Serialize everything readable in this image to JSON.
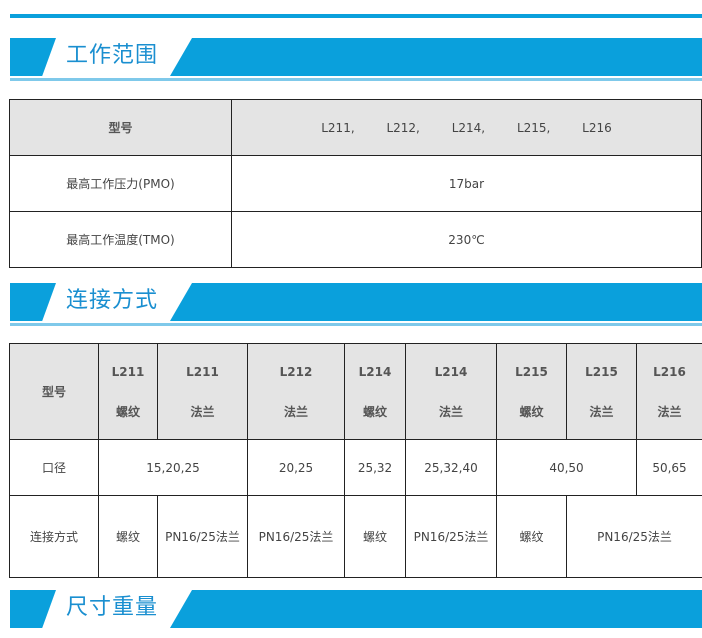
{
  "sections": {
    "working_range": {
      "title": "工作范围"
    },
    "connection": {
      "title": "连接方式"
    },
    "dimensions": {
      "title": "尺寸重量"
    }
  },
  "table1": {
    "header": {
      "label": "型号",
      "models": [
        "L211,",
        "L212,",
        "L214,",
        "L215,",
        "L216"
      ]
    },
    "rows": [
      {
        "label": "最高工作压力(PMO)",
        "value": "17bar"
      },
      {
        "label": "最高工作温度(TMO)",
        "value": "230℃"
      }
    ]
  },
  "table2": {
    "header_label": "型号",
    "columns": [
      {
        "model": "L211",
        "type": "螺纹"
      },
      {
        "model": "L211",
        "type": "法兰"
      },
      {
        "model": "L212",
        "type": "法兰"
      },
      {
        "model": "L214",
        "type": "螺纹"
      },
      {
        "model": "L214",
        "type": "法兰"
      },
      {
        "model": "L215",
        "type": "螺纹"
      },
      {
        "model": "L215",
        "type": "法兰"
      },
      {
        "model": "L216",
        "type": "法兰"
      }
    ],
    "diameter": {
      "label": "口径",
      "values": [
        "15,20,25",
        "20,25",
        "25,32",
        "25,32,40",
        "40,50",
        "50,65"
      ]
    },
    "connection": {
      "label": "连接方式",
      "values": [
        "螺纹",
        "PN16/25法兰",
        "PN16/25法兰",
        "螺纹",
        "PN16/25法兰",
        "螺纹",
        "PN16/25法兰"
      ]
    }
  }
}
